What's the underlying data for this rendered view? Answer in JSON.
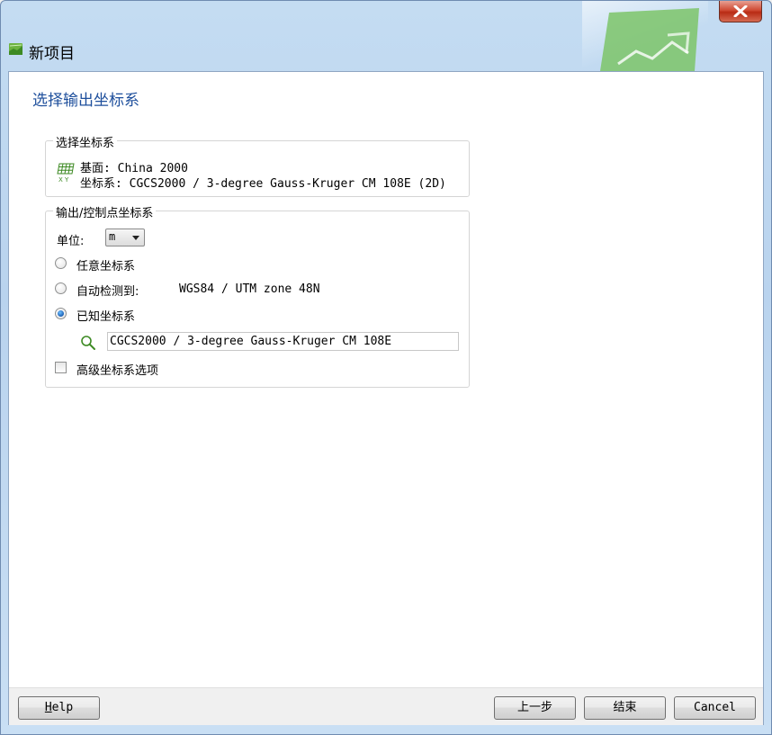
{
  "window": {
    "title": "新项目",
    "close_icon": "close-icon"
  },
  "page": {
    "title": "选择输出坐标系"
  },
  "selected_crs": {
    "legend": "选择坐标系",
    "icon": "xy-grid-icon",
    "datum": "基面: China 2000",
    "crs": "坐标系: CGCS2000 / 3-degree Gauss-Kruger CM 108E (2D)"
  },
  "output_crs": {
    "legend": "输出/控制点坐标系",
    "unit_label": "单位:",
    "unit_value": "m",
    "options": [
      {
        "label": "任意坐标系",
        "checked": false
      },
      {
        "label": "自动检测到:",
        "detected": "WGS84 / UTM zone 48N",
        "checked": false
      },
      {
        "label": "已知坐标系",
        "checked": true
      }
    ],
    "known_crs_value": "CGCS2000 / 3-degree Gauss-Kruger CM 108E",
    "advanced_label": "高级坐标系选项",
    "advanced_checked": false
  },
  "footer": {
    "help_first": "H",
    "help_rest": "elp",
    "prev": "上一步",
    "finish": "结束",
    "cancel": "Cancel"
  },
  "colors": {
    "title_text": "#1e4f9c",
    "close_button": "#c8402a",
    "radio_checked": "#1a5fb4"
  }
}
